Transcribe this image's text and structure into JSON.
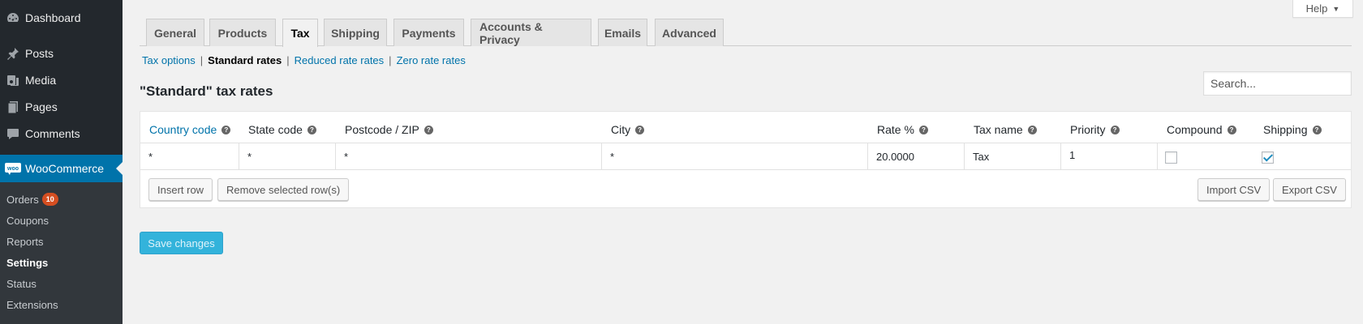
{
  "sidebar": {
    "menu": [
      {
        "label": "Dashboard",
        "icon": "dashboard-icon"
      },
      {
        "label": "Posts",
        "icon": "pin-icon"
      },
      {
        "label": "Media",
        "icon": "media-icon"
      },
      {
        "label": "Pages",
        "icon": "pages-icon"
      },
      {
        "label": "Comments",
        "icon": "comment-icon"
      },
      {
        "label": "WooCommerce",
        "icon": "woo-icon",
        "icon_text": "woo"
      }
    ],
    "submenu": [
      {
        "label": "Orders",
        "badge": "10"
      },
      {
        "label": "Coupons"
      },
      {
        "label": "Reports"
      },
      {
        "label": "Settings"
      },
      {
        "label": "Status"
      },
      {
        "label": "Extensions"
      }
    ]
  },
  "help": {
    "label": "Help",
    "arrow": "▼"
  },
  "tabs": [
    "General",
    "Products",
    "Tax",
    "Shipping",
    "Payments",
    "Accounts & Privacy",
    "Emails",
    "Advanced"
  ],
  "active_tab": "Tax",
  "subnav": {
    "items": [
      "Tax options",
      "Standard rates",
      "Reduced rate rates",
      "Zero rate rates"
    ],
    "separator": "|",
    "current": "Standard rates"
  },
  "page_title": "\"Standard\" tax rates",
  "search": {
    "placeholder": "Search..."
  },
  "table": {
    "columns": [
      "Country code",
      "State code",
      "Postcode / ZIP",
      "City",
      "Rate %",
      "Tax name",
      "Priority",
      "Compound",
      "Shipping"
    ],
    "help_glyph": "?",
    "rows": [
      {
        "country": "*",
        "state": "*",
        "postcode": "*",
        "city": "*",
        "rate": "20.0000",
        "name": "Tax",
        "priority": "1",
        "compound": false,
        "shipping": true
      }
    ]
  },
  "buttons": {
    "insert_row": "Insert row",
    "remove_rows": "Remove selected row(s)",
    "import_csv": "Import CSV",
    "export_csv": "Export CSV",
    "save": "Save changes"
  },
  "colors": {
    "sidebar_bg": "#23282d",
    "active_menu": "#0073aa",
    "link": "#0073aa",
    "badge": "#d54e21",
    "save_button": "#33b3db"
  }
}
